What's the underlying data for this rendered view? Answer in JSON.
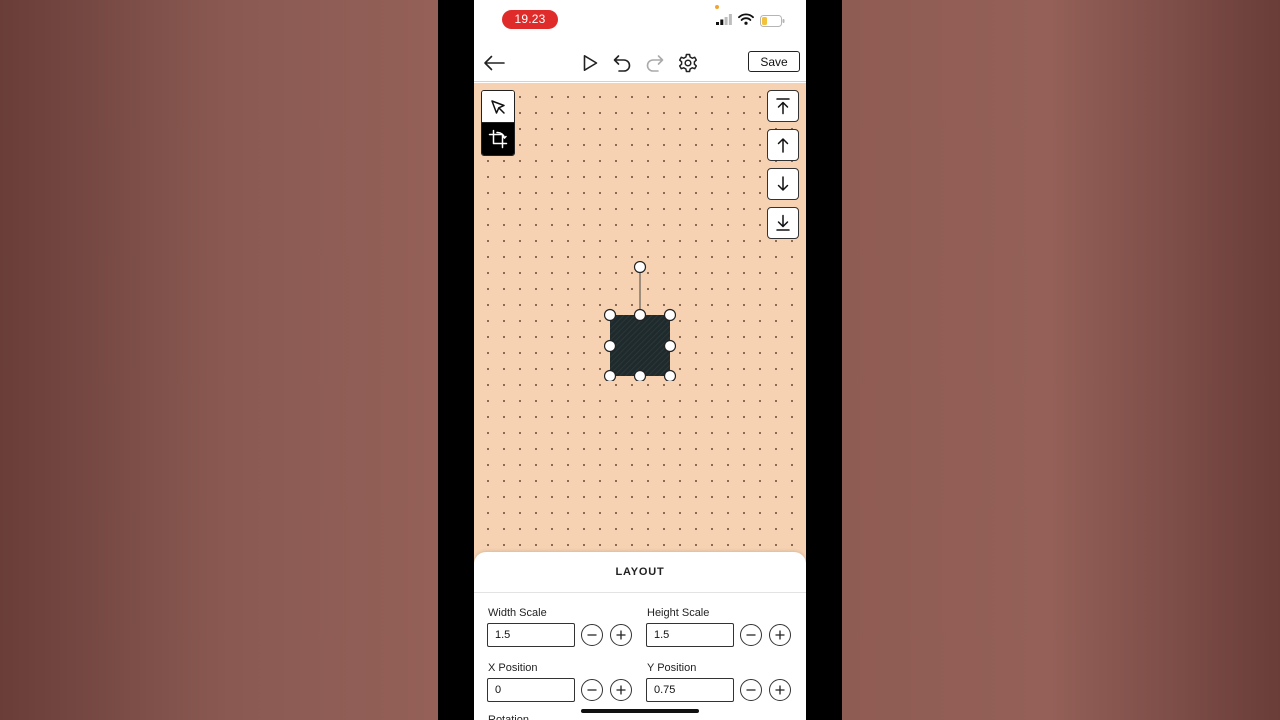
{
  "status_bar": {
    "time": "19.23",
    "icons": [
      "signal-icon",
      "wifi-icon",
      "battery-icon"
    ]
  },
  "toolbar": {
    "save_label": "Save",
    "icons": [
      "back-arrow-icon",
      "play-icon",
      "undo-icon",
      "redo-icon",
      "gear-icon"
    ]
  },
  "canvas": {
    "background_color": "#f6d2b2",
    "tools": [
      "select-pointer-icon",
      "transform-crop-icon"
    ],
    "layer_order_icons": [
      "bring-to-front-icon",
      "bring-forward-icon",
      "send-backward-icon",
      "send-to-back-icon"
    ],
    "shape_color": "#1f2a2c"
  },
  "layout_panel": {
    "title": "LAYOUT",
    "fields": [
      {
        "label": "Width Scale",
        "value": "1.5"
      },
      {
        "label": "Height Scale",
        "value": "1.5"
      },
      {
        "label": "X Position",
        "value": "0"
      },
      {
        "label": "Y Position",
        "value": "0.75"
      }
    ],
    "partial_label": "Rotation"
  }
}
